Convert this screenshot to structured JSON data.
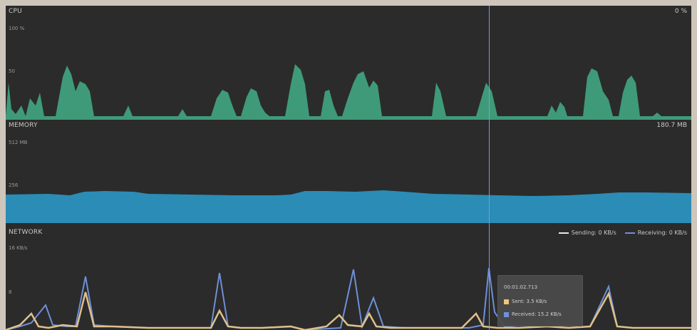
{
  "cpu": {
    "title": "CPU",
    "value": "0 %",
    "max_label": "100 %",
    "mid_label": "50",
    "fill_color": "#3f9a79"
  },
  "memory": {
    "title": "MEMORY",
    "value": "180.7 MB",
    "max_label": "512 MB",
    "mid_label": "256",
    "fill_color": "#2b8cb6"
  },
  "network": {
    "title": "NETWORK",
    "max_label": "16 KB/s",
    "mid_label": "8",
    "legend": [
      {
        "label": "Sending: 0 KB/s",
        "color": "#e8e8e8"
      },
      {
        "label": "Receiving: 0 KB/s",
        "color": "#6f8fd8"
      }
    ],
    "sending_color": "#e0c18a",
    "receiving_color": "#6f8fd8"
  },
  "tooltip": {
    "time": "00:01:02.713",
    "sent_label": "Sent: 3.5 KB/s",
    "received_label": "Received: 15.2 KB/s",
    "sent_color": "#f0c27a",
    "received_color": "#6f8fd8"
  },
  "cursor_color": "#6f9ee8"
}
